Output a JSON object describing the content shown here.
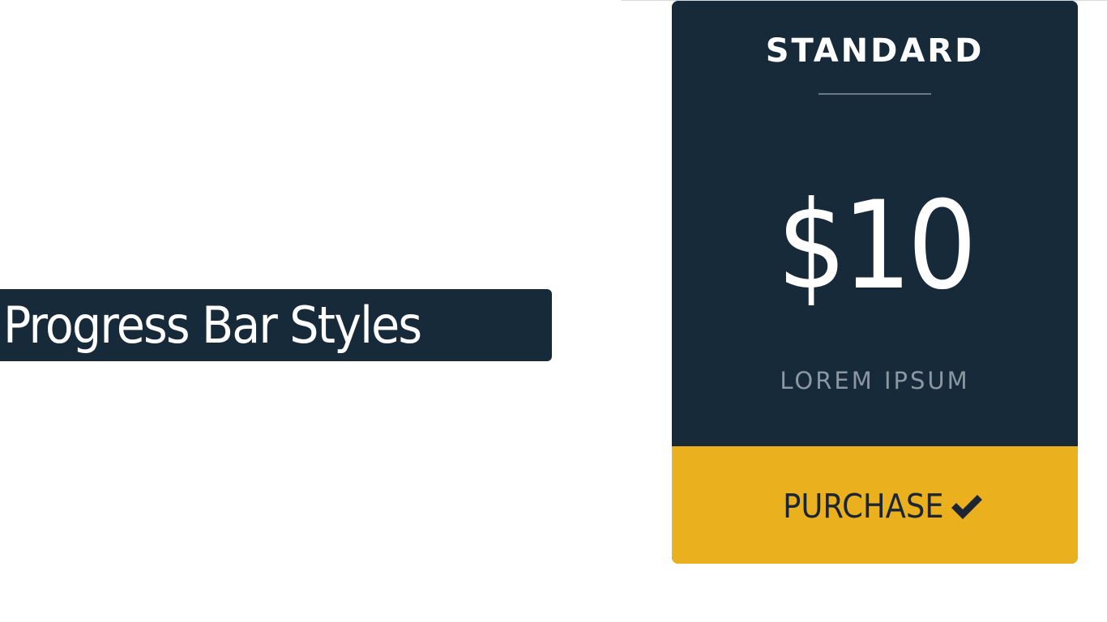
{
  "banner": {
    "title": "Progress Bar Styles"
  },
  "pricing_card": {
    "plan_name": "STANDARD",
    "price": "$10",
    "subtext": "LOREM IPSUM",
    "purchase_label": "PURCHASE",
    "purchase_icon": "check-icon"
  },
  "colors": {
    "card_background": "#172a3a",
    "purchase_background": "#eab01e",
    "purchase_text": "#1b2533",
    "subtext": "#8b97a2",
    "banner_background": "#172a3a"
  }
}
